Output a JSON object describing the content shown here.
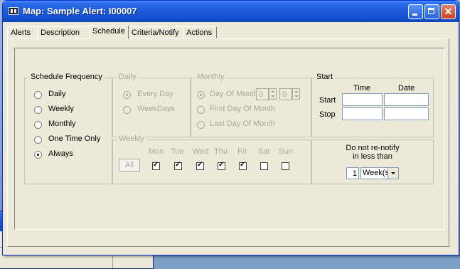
{
  "window": {
    "title": "Map: Sample   Alert: I00007"
  },
  "tabs": [
    {
      "label": "Alerts"
    },
    {
      "label": "Description"
    },
    {
      "label": "Schedule",
      "active": true
    },
    {
      "label": "Criteria/Notify"
    },
    {
      "label": "Actions"
    }
  ],
  "schedule_frequency": {
    "title": "Schedule Frequency",
    "options": [
      {
        "label": "Daily",
        "selected": false
      },
      {
        "label": "Weekly",
        "selected": false
      },
      {
        "label": "Monthly",
        "selected": false
      },
      {
        "label": "One Time Only",
        "selected": false
      },
      {
        "label": "Always",
        "selected": true
      }
    ]
  },
  "daily": {
    "title": "Daily",
    "options": [
      {
        "label": "Every Day",
        "selected": true
      },
      {
        "label": "WeekDays",
        "selected": false
      }
    ]
  },
  "monthly": {
    "title": "Monthly",
    "day_of_month_label": "Day Of Month",
    "day_value": "0",
    "month_value": "0",
    "first_label": "First Day Of Month",
    "last_label": "Last Day Of Month"
  },
  "weekly": {
    "title": "Weekly",
    "all_button": "All",
    "days": [
      {
        "label": "Mon",
        "checked": true
      },
      {
        "label": "Tue",
        "checked": true
      },
      {
        "label": "Wed",
        "checked": true
      },
      {
        "label": "Thu",
        "checked": true
      },
      {
        "label": "Fri",
        "checked": true
      },
      {
        "label": "Sat",
        "checked": false
      },
      {
        "label": "Sun",
        "checked": false
      }
    ]
  },
  "start": {
    "title": "Start",
    "time_header": "Time",
    "date_header": "Date",
    "start_label": "Start",
    "stop_label": "Stop",
    "start_time": "",
    "start_date": "",
    "stop_time": "",
    "stop_date": ""
  },
  "renotify": {
    "line1": "Do not re-notify",
    "line2": "in less than",
    "count": "1",
    "unit": "Week(s)"
  },
  "colors": {
    "titlebar": "#1b5bd9",
    "dialog_bg": "#ece9d8",
    "disabled_text": "#aca899"
  }
}
